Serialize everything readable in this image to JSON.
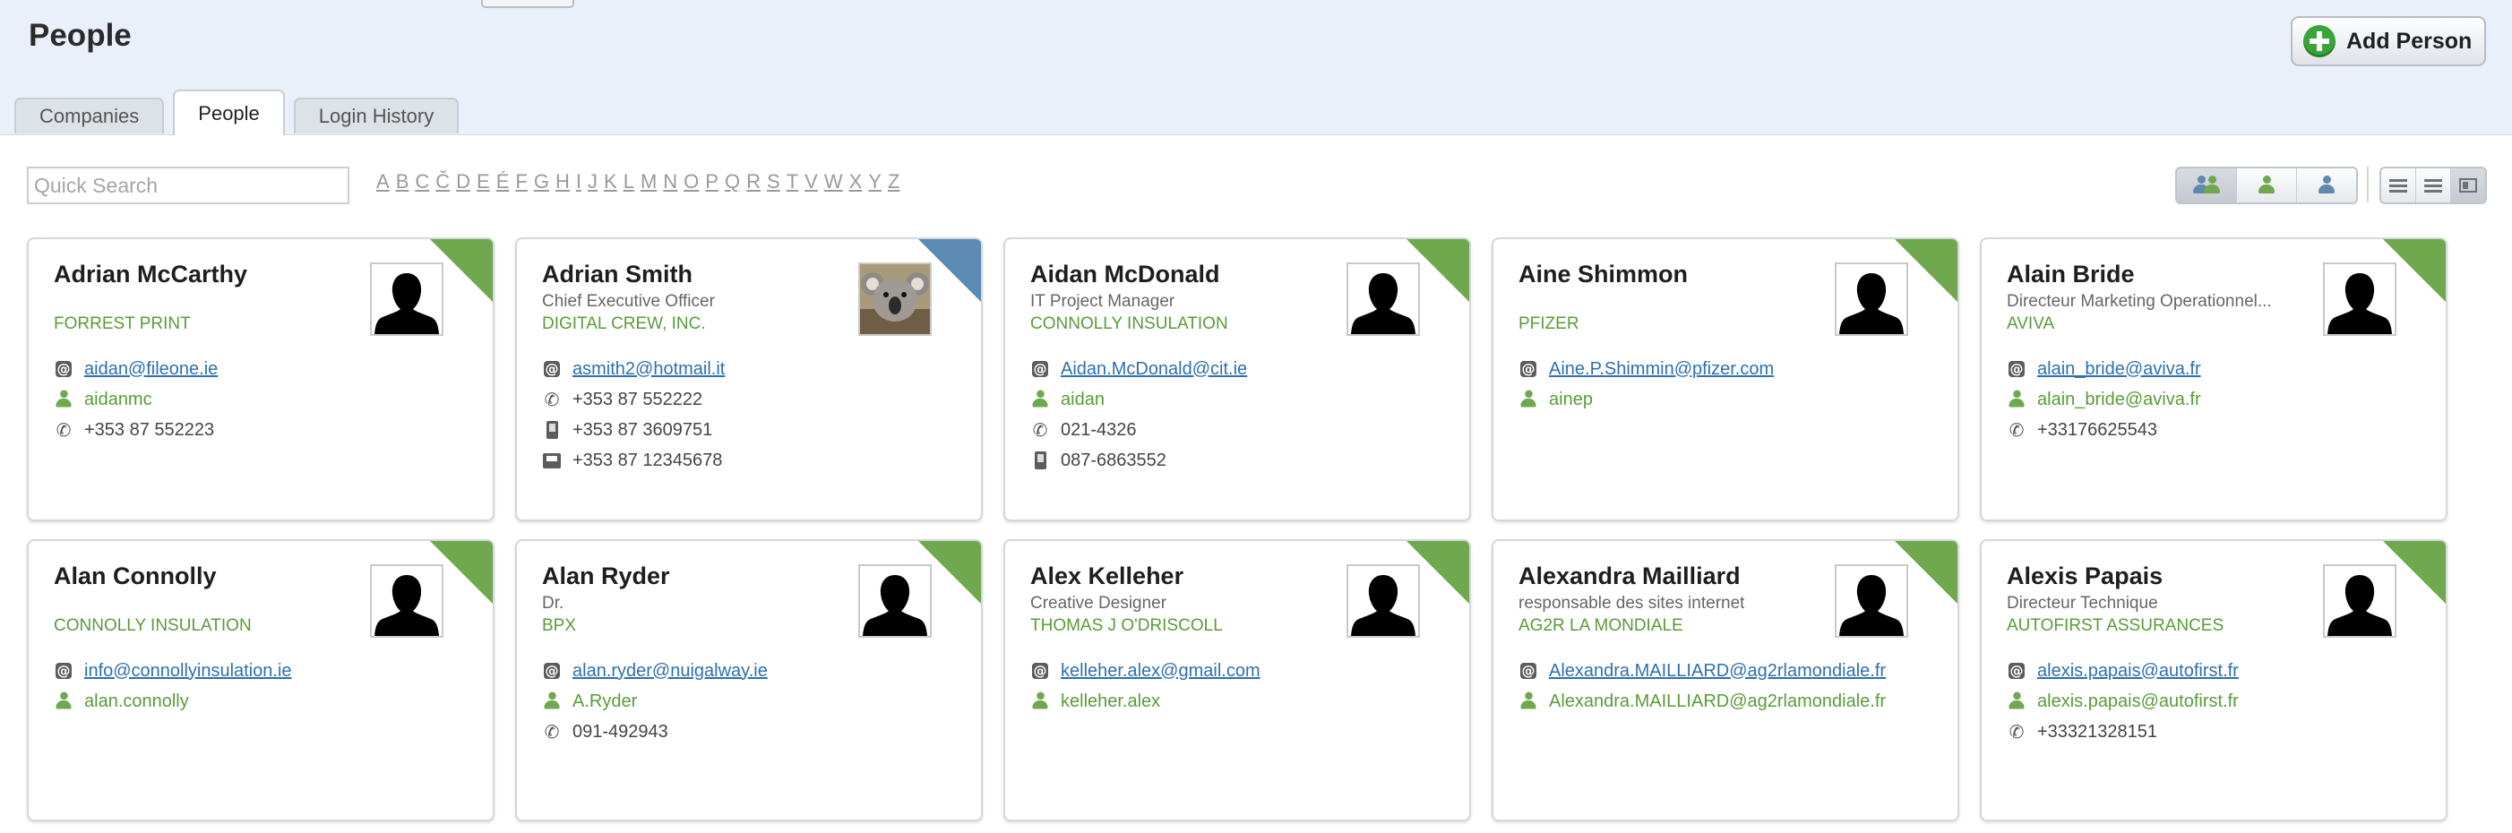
{
  "page": {
    "title": "People",
    "add_button": "Add Person",
    "tabs": [
      "Companies",
      "People",
      "Login History"
    ],
    "active_tab": "People"
  },
  "toolbar": {
    "search_placeholder": "Quick Search",
    "letters": [
      "A",
      "B",
      "C",
      "Č",
      "D",
      "E",
      "É",
      "F",
      "G",
      "H",
      "I",
      "J",
      "K",
      "L",
      "M",
      "N",
      "O",
      "P",
      "Q",
      "R",
      "S",
      "T",
      "V",
      "W",
      "X",
      "Y",
      "Z"
    ]
  },
  "colors": {
    "accent_green": "#6fa84e",
    "accent_blue": "#5b8ab3",
    "link": "#2f6fb0"
  },
  "people": [
    {
      "name": "Adrian McCarthy",
      "title": "",
      "company": "FORREST PRINT",
      "corner": "green",
      "photo": "silhouette",
      "contacts": [
        {
          "type": "email",
          "value": "aidan@fileone.ie"
        },
        {
          "type": "user",
          "value": "aidanmc"
        },
        {
          "type": "phone",
          "value": "+353 87 552223"
        }
      ]
    },
    {
      "name": "Adrian Smith",
      "title": "Chief Executive Officer",
      "company": "DIGITAL CREW, INC.",
      "corner": "blue",
      "photo": "koala",
      "contacts": [
        {
          "type": "email",
          "value": "asmith2@hotmail.it"
        },
        {
          "type": "phone",
          "value": "+353 87 552222"
        },
        {
          "type": "mobile",
          "value": "+353 87 3609751"
        },
        {
          "type": "fax",
          "value": "+353 87 12345678"
        }
      ]
    },
    {
      "name": "Aidan McDonald",
      "title": "IT Project Manager",
      "company": "CONNOLLY INSULATION",
      "corner": "green",
      "photo": "silhouette",
      "contacts": [
        {
          "type": "email",
          "value": "Aidan.McDonald@cit.ie"
        },
        {
          "type": "user",
          "value": "aidan"
        },
        {
          "type": "phone",
          "value": "021-4326"
        },
        {
          "type": "mobile",
          "value": "087-6863552"
        }
      ]
    },
    {
      "name": "Aine Shimmon",
      "title": "",
      "company": "PFIZER",
      "corner": "green",
      "photo": "silhouette",
      "contacts": [
        {
          "type": "email",
          "value": "Aine.P.Shimmin@pfizer.com"
        },
        {
          "type": "user",
          "value": "ainep"
        }
      ]
    },
    {
      "name": "Alain Bride",
      "title": "Directeur Marketing Operationnel...",
      "company": "AVIVA",
      "corner": "green",
      "photo": "silhouette",
      "contacts": [
        {
          "type": "email",
          "value": "alain_bride@aviva.fr"
        },
        {
          "type": "user",
          "value": "alain_bride@aviva.fr"
        },
        {
          "type": "phone",
          "value": "+33176625543"
        }
      ]
    },
    {
      "name": "Alan Connolly",
      "title": "",
      "company": "CONNOLLY INSULATION",
      "corner": "green",
      "photo": "silhouette",
      "contacts": [
        {
          "type": "email",
          "value": "info@connollyinsulation.ie"
        },
        {
          "type": "user",
          "value": "alan.connolly"
        }
      ]
    },
    {
      "name": "Alan Ryder",
      "title": "Dr.",
      "company": "BPX",
      "corner": "green",
      "photo": "silhouette",
      "contacts": [
        {
          "type": "email",
          "value": "alan.ryder@nuigalway.ie"
        },
        {
          "type": "user",
          "value": "A.Ryder"
        },
        {
          "type": "phone",
          "value": "091-492943"
        }
      ]
    },
    {
      "name": "Alex Kelleher",
      "title": "Creative Designer",
      "company": "THOMAS J O'DRISCOLL",
      "corner": "green",
      "photo": "silhouette",
      "contacts": [
        {
          "type": "email",
          "value": "kelleher.alex@gmail.com"
        },
        {
          "type": "user",
          "value": "kelleher.alex"
        }
      ]
    },
    {
      "name": "Alexandra Mailliard",
      "title": "responsable des sites internet",
      "company": "AG2R LA MONDIALE",
      "corner": "green",
      "photo": "silhouette",
      "contacts": [
        {
          "type": "email",
          "value": "Alexandra.MAILLIARD@ag2rlamondiale.fr"
        },
        {
          "type": "user",
          "value": "Alexandra.MAILLIARD@ag2rlamondiale.fr"
        }
      ]
    },
    {
      "name": "Alexis Papais",
      "title": "Directeur Technique",
      "company": "AUTOFIRST ASSURANCES",
      "corner": "green",
      "photo": "silhouette",
      "contacts": [
        {
          "type": "email",
          "value": "alexis.papais@autofirst.fr"
        },
        {
          "type": "user",
          "value": "alexis.papais@autofirst.fr"
        },
        {
          "type": "phone",
          "value": "+33321328151"
        }
      ]
    }
  ]
}
